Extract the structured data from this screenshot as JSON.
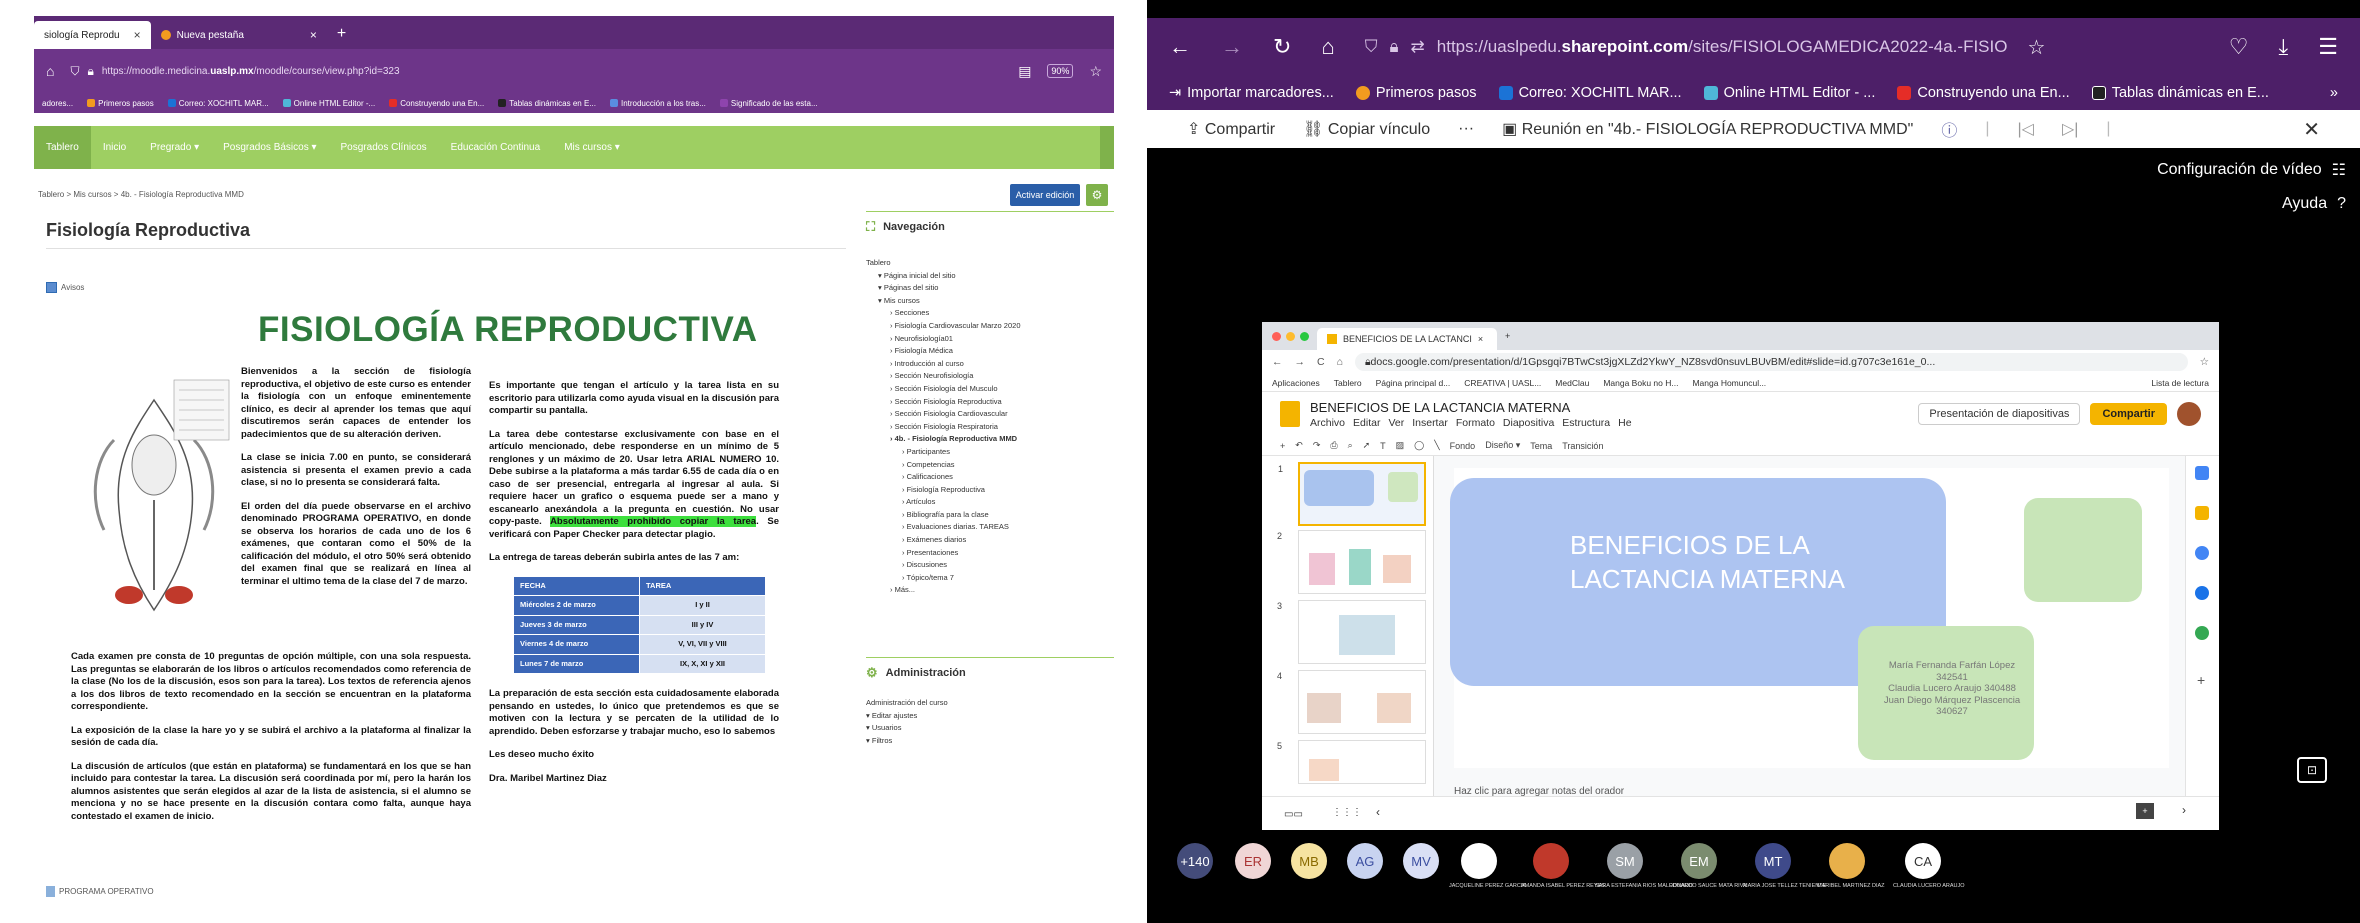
{
  "left_browser": {
    "tabs": [
      {
        "label": "siología Reprodu",
        "active": true
      },
      {
        "label": "Nueva pestaña",
        "active": false
      }
    ],
    "url": {
      "prefix": "https://moodle.medicina.",
      "host": "uaslp.mx",
      "path": "/moodle/course/view.php?id=323"
    },
    "zoom": "90%",
    "bookmarks": [
      "adores...",
      "Primeros pasos",
      "Correo: XOCHITL MAR...",
      "Online HTML Editor -...",
      "Construyendo una En...",
      "Tablas dinámicas en E...",
      "Introducción a los tras...",
      "Significado de las esta..."
    ]
  },
  "moodle": {
    "menu": [
      "Tablero",
      "Inicio",
      "Pregrado ▾",
      "Posgrados Básicos ▾",
      "Posgrados Clínicos",
      "Educación Continua",
      "Mis cursos ▾"
    ],
    "breadcrumb": "Tablero > Mis cursos > 4b. - Fisiología Reproductiva MMD",
    "edit_button": "Activar edición",
    "course_title": "Fisiología Reproductiva",
    "avisos": "Avisos",
    "banner_title": "FISIOLOGÍA REPRODUCTIVA",
    "col1_paragraphs": [
      "Bienvenidos a la sección de fisiología reproductiva, el objetivo de este curso es entender la fisiología con un enfoque eminentemente clínico, es decir al aprender los temas que aquí discutiremos serán capaces de entender los padecimientos que de su alteración deriven.",
      "La clase se inicia 7.00 en punto, se considerará asistencia si presenta el examen previo a cada clase, si no lo presenta se considerará falta.",
      "El orden del día puede observarse en el archivo denominado PROGRAMA OPERATIVO, en donde se observa los horarios de cada uno de los 6 exámenes, que contaran como el 50% de la calificación del módulo, el otro 50% será obtenido del examen final que se realizará en línea al terminar el ultimo tema de la clase del 7 de marzo."
    ],
    "full_paragraphs": [
      "Cada examen pre consta de 10 preguntas de opción múltiple, con una sola respuesta. Las preguntas se elaborarán de los libros o artículos recomendados como referencia de la clase (No los de la discusión, esos son para la tarea). Los textos de referencia ajenos a los dos libros de texto recomendado en la sección se encuentran en la plataforma correspondiente.",
      "La exposición de la clase la hare yo y se subirá el archivo a la plataforma al finalizar la sesión de cada día.",
      "La discusión de artículos (que están en plataforma) se fundamentará en los que se han incluido para contestar la tarea. La discusión será coordinada por mí, pero la harán los alumnos asistentes que serán elegidos al azar de la lista de asistencia, si el alumno se menciona y no se hace presente en la discusión contara como falta, aunque haya contestado el examen de inicio."
    ],
    "col2_p1": "Es importante que tengan el artículo y la tarea lista en su escritorio para utilizarla como ayuda visual en la discusión para compartir su pantalla.",
    "col2_p2_a": "La tarea debe contestarse exclusivamente con base en el artículo mencionado, debe responderse en un mínimo de 5 renglones y un máximo de 20. Usar letra ARIAL NUMERO 10. Debe subirse a la plataforma a más tardar 6.55 de cada día o en caso de ser presencial, entregarla al ingresar al aula. Si requiere hacer un grafico o esquema puede ser a mano y escanearlo anexándola a la pregunta en cuestión. No usar copy-paste. ",
    "col2_p2_hl": "Absolutamente prohibido copiar la tarea",
    "col2_p2_b": ". Se verificará con Paper Checker para detectar plagio.",
    "col2_p3": "La entrega de tareas deberán subirla antes de las 7 am:",
    "table": {
      "headers": [
        "FECHA",
        "TAREA"
      ],
      "rows": [
        [
          "Miércoles 2 de marzo",
          "I y II"
        ],
        [
          "Jueves 3 de marzo",
          "III y IV"
        ],
        [
          "Viernes 4 de marzo",
          "V, VI, VII y VIII"
        ],
        [
          "Lunes 7 de marzo",
          "IX, X, XI y XII"
        ]
      ]
    },
    "col2_p4": "La preparación de esta sección esta cuidadosamente elaborada pensando en ustedes, lo único que pretendemos es que se motiven con la lectura y se percaten de la utilidad de lo aprendido. Deben esforzarse y trabajar mucho, eso lo sabemos",
    "col2_p5": "Les deseo mucho éxito",
    "col2_p6": "Dra. Maribel Martinez Diaz",
    "programa": "PROGRAMA OPERATIVO",
    "nav_title": "Navegación",
    "nav_items": [
      {
        "t": "Tablero",
        "l": 0
      },
      {
        "t": "Página inicial del sitio",
        "l": 1
      },
      {
        "t": "Páginas del sitio",
        "l": 1
      },
      {
        "t": "Mis cursos",
        "l": 1
      },
      {
        "t": "Secciones",
        "l": 2
      },
      {
        "t": "Fisiología Cardiovascular Marzo 2020",
        "l": 2
      },
      {
        "t": "Neurofisiología01",
        "l": 2
      },
      {
        "t": "Fisiología Médica",
        "l": 2
      },
      {
        "t": "Introducción al curso",
        "l": 2
      },
      {
        "t": "Sección Neurofisiología",
        "l": 2
      },
      {
        "t": "Sección Fisiología del Musculo",
        "l": 2
      },
      {
        "t": "Sección Fisiología Reproductiva",
        "l": 2
      },
      {
        "t": "Sección Fisiología Cardiovascular",
        "l": 2
      },
      {
        "t": "Sección Fisiología Respiratoria",
        "l": 2
      },
      {
        "t": "4b. - Fisiología Reproductiva MMD",
        "l": 2,
        "b": true
      },
      {
        "t": "Participantes",
        "l": 3
      },
      {
        "t": "Competencias",
        "l": 3
      },
      {
        "t": "Calificaciones",
        "l": 3
      },
      {
        "t": "Fisiología Reproductiva",
        "l": 3
      },
      {
        "t": "Artículos",
        "l": 3
      },
      {
        "t": "Bibliografía para la clase",
        "l": 3
      },
      {
        "t": "Evaluaciones diarias. TAREAS",
        "l": 3
      },
      {
        "t": "Exámenes diarios",
        "l": 3
      },
      {
        "t": "Presentaciones",
        "l": 3
      },
      {
        "t": "Discusiones",
        "l": 3
      },
      {
        "t": "Tópico/tema 7",
        "l": 3
      },
      {
        "t": "Más...",
        "l": 2
      }
    ],
    "admin_title": "Administración",
    "admin_items": [
      {
        "t": "Administración del curso",
        "l": 0
      },
      {
        "t": "Editar ajustes",
        "l": 1
      },
      {
        "t": "Usuarios",
        "l": 1
      },
      {
        "t": "Filtros",
        "l": 1
      }
    ]
  },
  "right_browser": {
    "url": {
      "prefix": "https://uaslpedu.",
      "host": "sharepoint.com",
      "path": "/sites/FISIOLOGAMEDICA2022-4a.-FISIO"
    },
    "bookmarks": [
      "Importar marcadores...",
      "Primeros pasos",
      "Correo: XOCHITL MAR...",
      "Online HTML Editor - ...",
      "Construyendo una En...",
      "Tablas dinámicas en E..."
    ],
    "meeting": {
      "share": "Compartir",
      "copy_link": "Copiar vínculo",
      "more": "···",
      "title": "Reunión en \"4b.- FISIOLOGÍA REPRODUCTIVA MMD\""
    },
    "video_config": "Configuración de vídeo",
    "help": "Ayuda"
  },
  "slides": {
    "tab": "BENEFICIOS DE LA LACTANCI",
    "url": "docs.google.com/presentation/d/1Gpsgqi7BTwCst3jgXLZd2YkwY_NZ8svd0nsuvLBUvBM/edit#slide=id.g707c3e161e_0...",
    "bookmarks": [
      "Aplicaciones",
      "Tablero",
      "Página principal d...",
      "CREATIVA | UASL...",
      "MedClau",
      "Manga Boku no H...",
      "Manga Homuncul...",
      "Lista de lectura"
    ],
    "doc_title": "BENEFICIOS DE LA LACTANCIA MATERNA",
    "menu": [
      "Archivo",
      "Editar",
      "Ver",
      "Insertar",
      "Formato",
      "Diapositiva",
      "Estructura",
      "He"
    ],
    "present": "Presentación de diapositivas",
    "share": "Compartir",
    "toolbar": [
      "Fondo",
      "Diseño ▾",
      "Tema",
      "Transición"
    ],
    "slide_title": "BENEFICIOS DE LA LACTANCIA MATERNA",
    "authors": [
      "María Fernanda Farfán López",
      "342541",
      "Claudia Lucero Araujo 340488",
      "Juan Diego Márquez Plascencia",
      "340627"
    ],
    "notes": "Haz clic para agregar notas del orador",
    "thumb_numbers": [
      "1",
      "2",
      "3",
      "4",
      "5"
    ]
  },
  "participants": [
    {
      "i": "+140",
      "c": "#444c7a",
      "n": ""
    },
    {
      "i": "ER",
      "c": "#f0d6d6",
      "t": "#a33",
      "n": ""
    },
    {
      "i": "MB",
      "c": "#f6e3a1",
      "t": "#8a6a00",
      "n": ""
    },
    {
      "i": "AG",
      "c": "#c8d3f0",
      "t": "#3b4ea0",
      "n": ""
    },
    {
      "i": "MV",
      "c": "#d9dff5",
      "t": "#3b4ea0",
      "n": ""
    },
    {
      "i": "",
      "c": "#ffffff",
      "n": "JACQUELINE PEREZ GARCIA"
    },
    {
      "i": "",
      "c": "#c0392b",
      "n": "AMANDA ISABEL PEREZ REYES"
    },
    {
      "i": "SM",
      "c": "#9aa0a6",
      "n": "SARA ESTEFANIA RIOS MALDONADO"
    },
    {
      "i": "EM",
      "c": "#7b8c6f",
      "n": "EDUARDO SAUCE MATA RIVA"
    },
    {
      "i": "MT",
      "c": "#3f4a8a",
      "n": "MARIA JOSE TELLEZ TENIENTE"
    },
    {
      "i": "",
      "c": "#e8b04a",
      "n": "MARIBEL MARTINEZ DIAZ"
    },
    {
      "i": "CA",
      "c": "#ffffff",
      "t": "#333",
      "n": "CLAUDIA LUCERO ARAUJO"
    }
  ],
  "colors": {
    "moodle_purple": "#6d3589",
    "moodle_green": "#9ecf62",
    "title_green": "#2f7a3d",
    "teams_purple": "#4d1f68",
    "slides_yellow": "#f4b400"
  }
}
